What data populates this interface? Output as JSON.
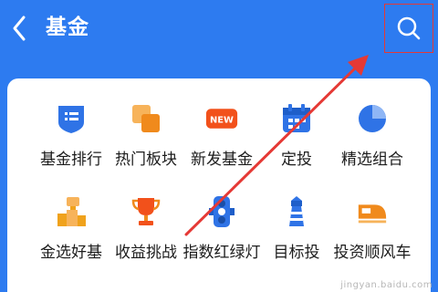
{
  "header": {
    "title": "基金",
    "back_icon": "chevron-left-icon",
    "search_icon": "search-icon",
    "background": "#2d7bf0"
  },
  "menu": {
    "rows": [
      [
        {
          "label": "基金排行",
          "icon": "list-shield-icon",
          "color": "#2f73e6"
        },
        {
          "label": "热门板块",
          "icon": "stacked-squares-icon",
          "color": "#f08a1c"
        },
        {
          "label": "新发基金",
          "icon": "new-badge-icon",
          "color": "#f2511b"
        },
        {
          "label": "定投",
          "icon": "calendar-icon",
          "color": "#2f73e6"
        },
        {
          "label": "精选组合",
          "icon": "pie-chart-icon",
          "color": "#2f73e6"
        }
      ],
      [
        {
          "label": "金选好基",
          "icon": "trophy-podium-icon",
          "color": "#f0a21c"
        },
        {
          "label": "收益挑战",
          "icon": "cup-icon",
          "color": "#f2511b"
        },
        {
          "label": "指数红绿灯",
          "icon": "traffic-light-icon",
          "color": "#2f73e6"
        },
        {
          "label": "目标投",
          "icon": "lighthouse-icon",
          "color": "#2f73e6"
        },
        {
          "label": "投资顺风车",
          "icon": "train-icon",
          "color": "#f08a1c"
        }
      ]
    ]
  },
  "annotation": {
    "arrow_color": "#e53935",
    "highlight_color": "#e53935"
  },
  "watermark": "jingyan.baidu.com"
}
